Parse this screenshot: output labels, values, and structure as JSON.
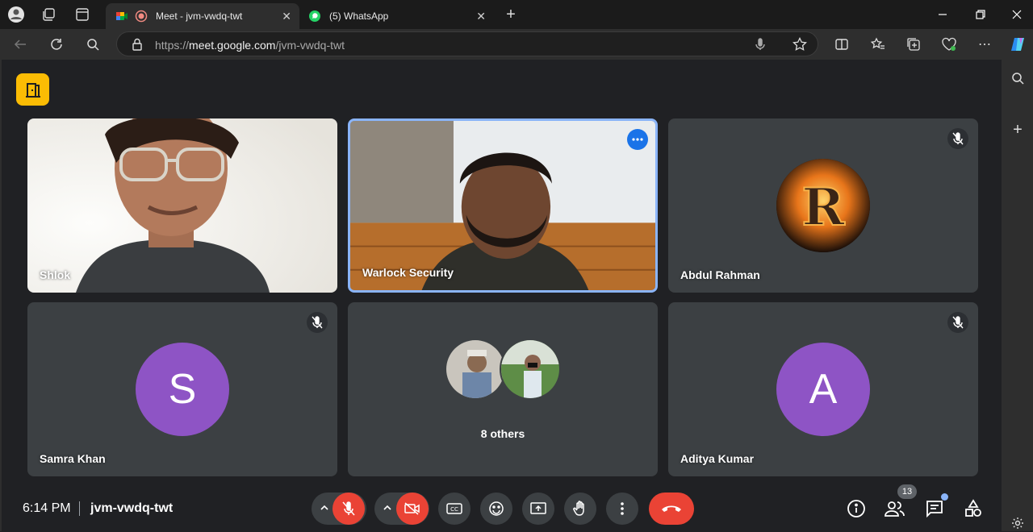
{
  "browser": {
    "tabs": [
      {
        "title": "Meet - jvm-vwdq-twt",
        "active": true
      },
      {
        "title": "(5) WhatsApp",
        "active": false
      }
    ],
    "url_prefix": "https://",
    "url_host": "meet.google.com",
    "url_path": "/jvm-vwdq-twt"
  },
  "meet": {
    "participants": [
      {
        "name": "Shlok",
        "video": true,
        "muted": false
      },
      {
        "name": "Warlock Security",
        "video": true,
        "muted": false,
        "highlighted": true
      },
      {
        "name": "Abdul Rahman",
        "video": false,
        "muted": true,
        "avatar_letter": "R"
      },
      {
        "name": "Samra Khan",
        "video": false,
        "muted": true,
        "avatar_letter": "S"
      },
      {
        "name": "8 others",
        "video": false,
        "muted": false
      },
      {
        "name": "Aditya Kumar",
        "video": false,
        "muted": true,
        "avatar_letter": "A"
      }
    ],
    "time": "6:14 PM",
    "meeting_code": "jvm-vwdq-twt",
    "people_count": "13"
  },
  "colors": {
    "accent": "#8ab4f8",
    "danger": "#ea4335",
    "avatar": "#8e54c5",
    "logo": "#fbbc04"
  }
}
